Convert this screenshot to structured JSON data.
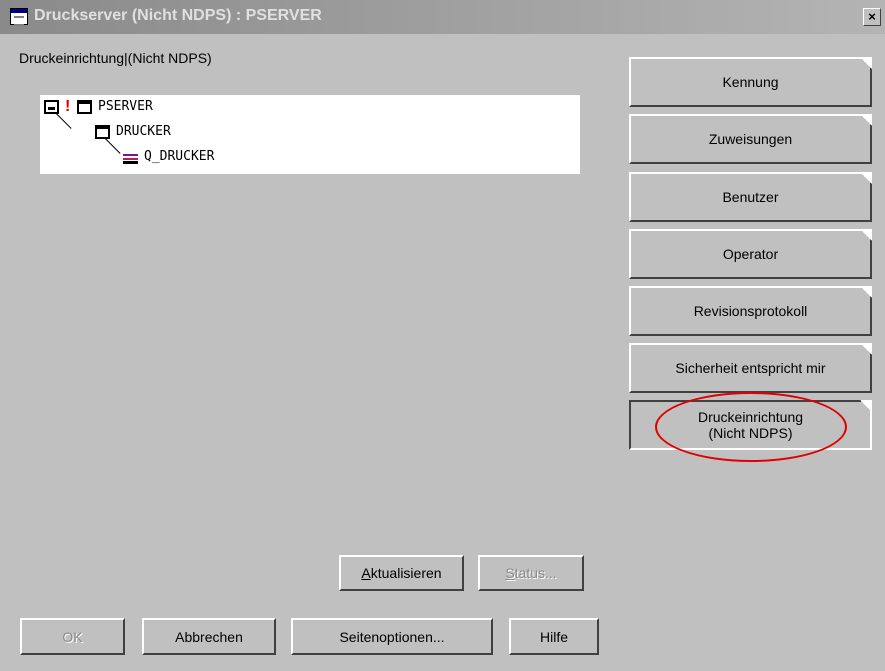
{
  "window": {
    "title": "Druckserver (Nicht NDPS) : PSERVER",
    "close_label": "×"
  },
  "panel": {
    "label": "Druckeinrichtung|(Nicht NDPS)"
  },
  "tree": {
    "nodes": [
      {
        "label": "PSERVER",
        "icon": "print-server-icon"
      },
      {
        "label": "DRUCKER",
        "icon": "printer-icon"
      },
      {
        "label": "Q_DRUCKER",
        "icon": "print-queue-icon"
      }
    ]
  },
  "actions": {
    "refresh_prefix": "A",
    "refresh_rest": "ktualisieren",
    "status_prefix": "S",
    "status_rest": "tatus..."
  },
  "sidebar": {
    "items": [
      {
        "label": "Kennung"
      },
      {
        "label": "Zuweisungen"
      },
      {
        "label": "Benutzer"
      },
      {
        "label": "Operator"
      },
      {
        "label": "Revisionsprotokoll"
      },
      {
        "label": "Sicherheit entspricht mir"
      },
      {
        "line1": "Druckeinrichtung",
        "line2": "(Nicht NDPS)",
        "active": true
      }
    ]
  },
  "footer": {
    "ok": "OK",
    "cancel": "Abbrechen",
    "page_options": "Seitenoptionen...",
    "help": "Hilfe"
  },
  "colors": {
    "highlight_marker": "#e00000"
  }
}
